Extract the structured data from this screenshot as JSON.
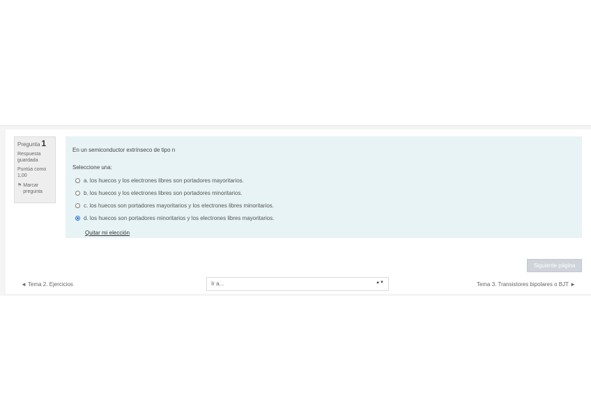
{
  "question_info": {
    "label": "Pregunta",
    "number": "1",
    "status": "Respuesta guardada",
    "points": "Puntúa como 1,00",
    "flag_label": "Marcar pregunta"
  },
  "question": {
    "text": "En un semiconductor extrínseco de tipo n",
    "prompt": "Seleccione una:",
    "options": [
      {
        "label": "a. los huecos y los electrones libres son portadores mayoritarios.",
        "checked": false
      },
      {
        "label": "b. los huecos y los electrones libres son portadores minoritarios.",
        "checked": false
      },
      {
        "label": "c. los huecos son portadores mayoritarios y los electrones libres minoritarios.",
        "checked": false
      },
      {
        "label": "d. los huecos son portadores minoritarios y los electrones libres mayoritarios.",
        "checked": true
      }
    ],
    "clear_choice": "Quitar mi elección"
  },
  "navigation": {
    "next_page_button": "Siguiente página",
    "prev_activity": "◄ Tema 2. Ejercicios",
    "jump_select": "Ir a...",
    "next_activity": "Tema 3. Transistores bipolares o BJT ►"
  }
}
